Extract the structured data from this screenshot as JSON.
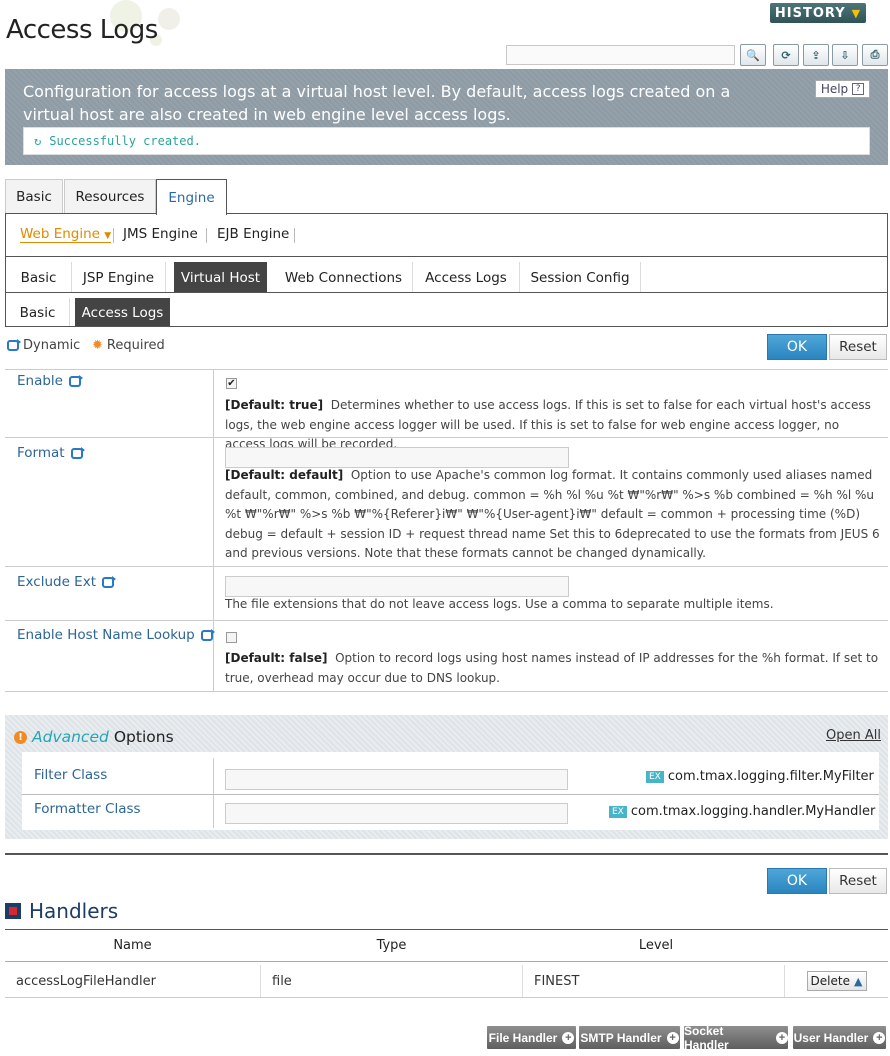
{
  "header": {
    "title": "Access Logs",
    "history_label": "HISTORY",
    "search_placeholder": ""
  },
  "description": {
    "text": "Configuration for access logs at a virtual host level. By default, access logs created on a virtual host are also created in web engine level access logs.",
    "help_label": "Help",
    "message": "Successfully created."
  },
  "tabs": [
    "Basic",
    "Resources",
    "Engine"
  ],
  "sub_nav": [
    "Web Engine",
    "JMS Engine",
    "EJB Engine"
  ],
  "engine_tabs": [
    "Basic",
    "JSP Engine",
    "Virtual Host",
    "Web Connections",
    "Access Logs",
    "Session Config"
  ],
  "vhost_tabs": [
    "Basic",
    "Access Logs"
  ],
  "legend": {
    "dynamic": "Dynamic",
    "required": "Required"
  },
  "buttons": {
    "ok": "OK",
    "reset": "Reset"
  },
  "fields": {
    "enable": {
      "label": "Enable",
      "checked": true,
      "default": "[Default: true]",
      "desc": "Determines whether to use access logs. If this is set to false for each virtual host's access logs, the web engine access logger will be used. If this is set to false for web engine access logger, no access logs will be recorded."
    },
    "format": {
      "label": "Format",
      "value": "",
      "default": "[Default: default]",
      "desc": "Option to use Apache's common log format. It contains commonly used aliases named default, common, combined, and debug. common = %h %l %u %t ₩\"%r₩\" %>s %b combined = %h %l %u %t ₩\"%r₩\" %>s %b ₩\"%{Referer}i₩\" ₩\"%{User-agent}i₩\" default = common + processing time (%D) debug = default + session ID + request thread name Set this to 6deprecated to use the formats from JEUS 6 and previous versions. Note that these formats cannot be changed dynamically."
    },
    "exclude_ext": {
      "label": "Exclude Ext",
      "value": "",
      "desc": "The file extensions that do not leave access logs. Use a comma to separate multiple items."
    },
    "host_lookup": {
      "label": "Enable Host Name Lookup",
      "checked": false,
      "default": "[Default: false]",
      "desc": "Option to record logs using host names instead of IP addresses for the %h format. If set to true, overhead may occur due to DNS lookup."
    }
  },
  "advanced": {
    "title_em": "Advanced",
    "title_rest": "Options",
    "open_all": "Open All",
    "ex_badge": "EX",
    "filter_label": "Filter Class",
    "filter_example": "com.tmax.logging.filter.MyFilter",
    "formatter_label": "Formatter Class",
    "formatter_example": "com.tmax.logging.handler.MyHandler"
  },
  "handlers": {
    "title": "Handlers",
    "columns": [
      "Name",
      "Type",
      "Level"
    ],
    "rows": [
      {
        "name": "accessLogFileHandler",
        "type": "file",
        "level": "FINEST",
        "action": "Delete"
      }
    ],
    "add_buttons": [
      "File Handler",
      "SMTP Handler",
      "Socket Handler",
      "User Handler"
    ]
  }
}
